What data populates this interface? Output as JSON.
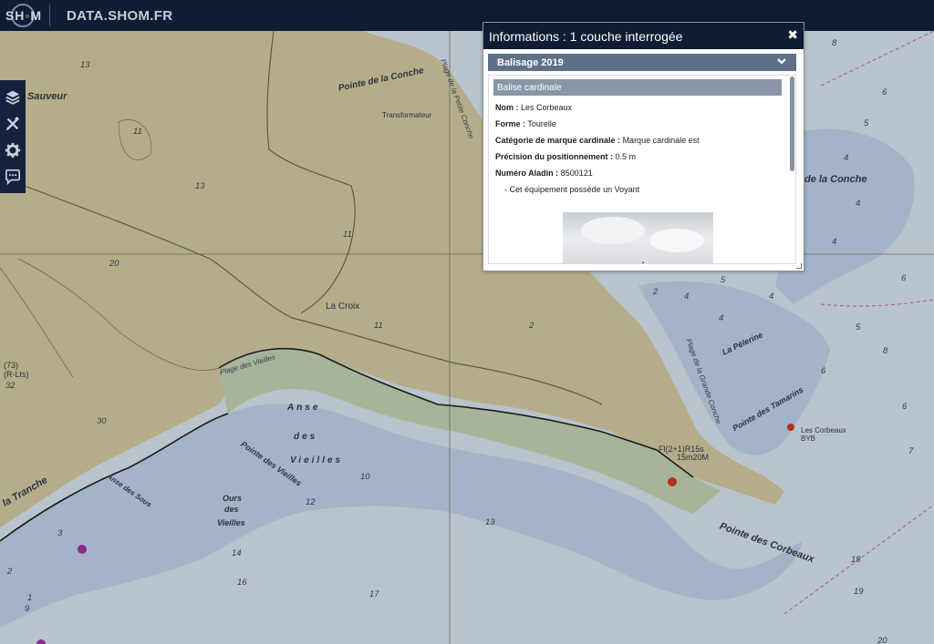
{
  "header": {
    "logo_text": "SH◦M",
    "site_title": "DATA.SHOM.FR"
  },
  "toolbar": {
    "tools": [
      {
        "icon": "layers-icon"
      },
      {
        "icon": "draw-tools-icon"
      },
      {
        "icon": "gear-icon"
      },
      {
        "icon": "chat-icon"
      }
    ]
  },
  "popup": {
    "title": "Informations : 1 couche interrogée",
    "close": "✖",
    "layer": "Balisage 2019",
    "feature": "Balise cardinale",
    "attributes": [
      {
        "label": "Nom :",
        "value": "Les Corbeaux"
      },
      {
        "label": "Forme :",
        "value": "Tourelle"
      },
      {
        "label": "Catégorie de marque cardinale :",
        "value": "Marque cardinale est"
      },
      {
        "label": "Précision du positionnement :",
        "value": "0.5 m"
      },
      {
        "label": "Numéro Aladin :",
        "value": "8500121"
      }
    ],
    "note": "- Cet équipement possède un Voyant"
  },
  "map": {
    "colors": {
      "land": "#b5ad8a",
      "shore": "#9fb29a",
      "shallow": "#9fb1c9",
      "deep": "#b9c3cb"
    },
    "places": [
      "Sauveur",
      "Pointe de la Conche",
      "Transformateur",
      "La Croix",
      "Plage des Vieilles",
      "Anse",
      "des",
      "Vieilles",
      "Pointe des Vieilles",
      "Anse des Sous",
      "Ours",
      "des",
      "Vieilles",
      "la Tranche",
      "de la Conche",
      "La Pèlerine",
      "Pointe des Tamarins",
      "Les Corbeaux",
      "BYB",
      "Fl(2+1)R15s",
      "15m20M",
      "Plage de la Grande Conche",
      "Pointe des Corbeaux",
      "Plage de la Petite Conche",
      "(73)",
      "(R-Lts)"
    ],
    "soundings": [
      "13",
      "11",
      "13",
      "20",
      "11",
      "30",
      "32",
      "8",
      "6",
      "5",
      "4",
      "4",
      "4",
      "6",
      "5",
      "2",
      "4",
      "5",
      "4",
      "4",
      "6",
      "5",
      "2",
      "10",
      "11",
      "12",
      "13",
      "14",
      "16",
      "17",
      "18",
      "19",
      "20",
      "6",
      "7",
      "8",
      "9",
      "3",
      "2",
      "1"
    ]
  }
}
